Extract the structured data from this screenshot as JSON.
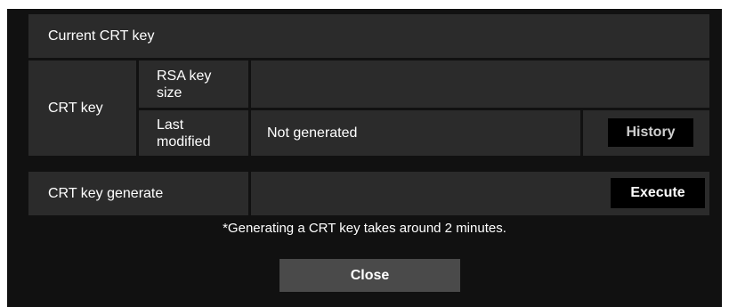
{
  "section_title": "Current CRT key",
  "crt_key": {
    "row_label": "CRT key",
    "rsa_key_size_label": "RSA key size",
    "rsa_key_size_value": "",
    "last_modified_label": "Last modified",
    "last_modified_value": "Not generated",
    "history_button": "History"
  },
  "generate": {
    "label": "CRT key generate",
    "execute_button": "Execute",
    "note": "*Generating a CRT key takes around 2 minutes."
  },
  "close_button": "Close",
  "colors": {
    "dialog_bg": "#111111",
    "cell_bg": "#2b2b2b",
    "button_bg": "#000000",
    "button_disabled_text": "#cfcfcf",
    "close_bg": "#4a4a4a"
  }
}
